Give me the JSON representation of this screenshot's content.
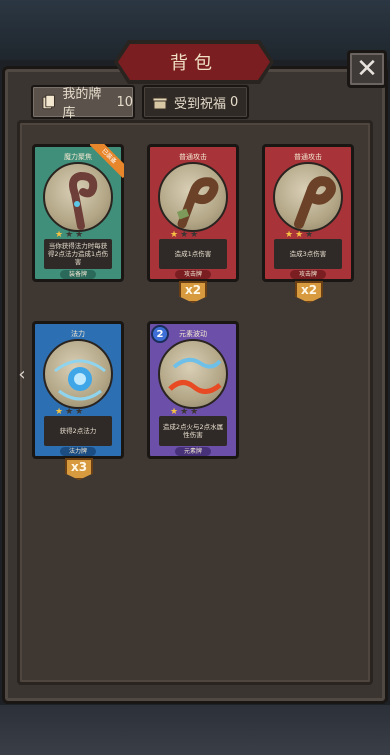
{
  "title": "背包",
  "close_label": "✕",
  "tabs": [
    {
      "label": "我的牌库",
      "count": "10"
    },
    {
      "label": "受到祝福",
      "count": "0"
    }
  ],
  "left_arrow": "‹",
  "cards": [
    {
      "name": "魔力聚焦",
      "stars_on": 1,
      "desc": "当你获得法力时每获得2点法力造成1点伤害",
      "type": "装备牌",
      "badge": "已装备",
      "count": ""
    },
    {
      "name": "普通攻击",
      "stars_on": 1,
      "desc": "造成1点伤害",
      "type": "攻击牌",
      "badge": "",
      "count": "x2"
    },
    {
      "name": "普通攻击",
      "stars_on": 2,
      "desc": "造成3点伤害",
      "type": "攻击牌",
      "badge": "",
      "count": "x2"
    },
    {
      "name": "法力",
      "stars_on": 1,
      "desc": "获得2点法力",
      "type": "法力牌",
      "badge": "",
      "count": "x3"
    },
    {
      "name": "元素波动",
      "stars_on": 1,
      "desc": "造成2点火与2点水属性伤害",
      "type": "元素牌",
      "badge": "",
      "count": "",
      "cost": "2"
    }
  ],
  "colors": {
    "equip": "#3f8f7a",
    "attack": "#a8343a",
    "mana": "#2c6fb2",
    "element": "#6b4fa8",
    "badge": "#d89a3e"
  }
}
